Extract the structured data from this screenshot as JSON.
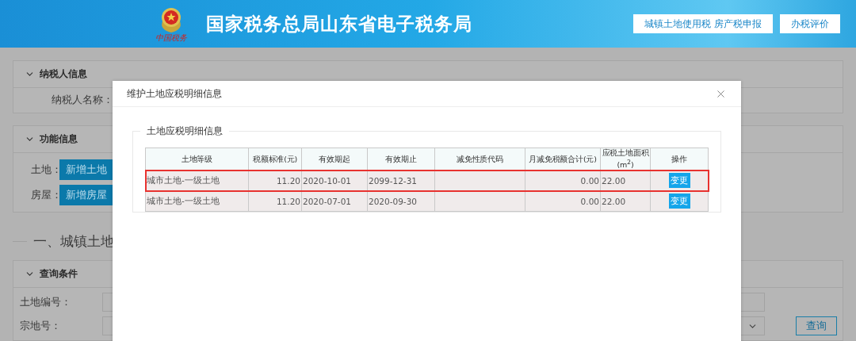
{
  "header": {
    "title": "国家税务总局山东省电子税务局",
    "emblem_caption": "中国税务",
    "buttons": [
      "城镇土地使用税 房产税申报",
      "办税评价"
    ]
  },
  "taxpayer_panel": {
    "title": "纳税人信息",
    "expanded": true,
    "label": "纳税人名称："
  },
  "function_panel": {
    "title": "功能信息",
    "expanded": true,
    "rows": [
      {
        "label": "土地：",
        "button": "新增土地"
      },
      {
        "label": "房屋：",
        "button": "新增房屋"
      }
    ]
  },
  "section_heading": "一、城镇土地",
  "query_panel": {
    "title": "查询条件",
    "expanded": true,
    "fields": [
      {
        "label": "土地编号：",
        "kind": "input"
      },
      {
        "label": "宗地号：",
        "kind": "select"
      }
    ],
    "button": "查询"
  },
  "modal": {
    "title": "维护土地应税明细信息",
    "section_title": "土地应税明细信息",
    "columns": [
      "土地等级",
      "税额标准(元)",
      "有效期起",
      "有效期止",
      "减免性质代码",
      "月减免税额合计(元)",
      "应税土地面积(m$^{2}$)",
      "操作"
    ],
    "rows": [
      {
        "highlighted": true,
        "cells": [
          "城市土地-一级土地",
          "11.20",
          "2020-10-01",
          "2099-12-31",
          "",
          "0.00",
          "22.00"
        ],
        "action": "变更"
      },
      {
        "highlighted": false,
        "cells": [
          "城市土地-一级土地",
          "11.20",
          "2020-07-01",
          "2020-09-30",
          "",
          "0.00",
          "22.00"
        ],
        "action": "变更"
      }
    ]
  }
}
